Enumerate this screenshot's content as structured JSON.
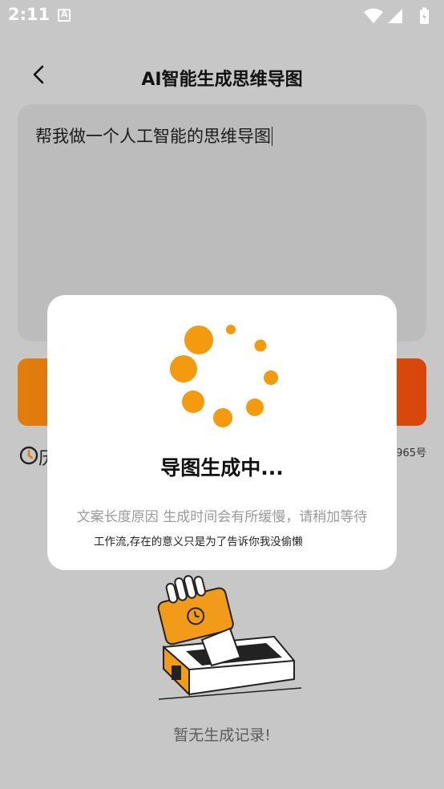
{
  "status_bar": {
    "time": "2:11"
  },
  "header": {
    "title": "AI智能生成思维导图"
  },
  "input": {
    "value": "帮我做一个人工智能的思维导图"
  },
  "history": {
    "label": "历",
    "queue_text": "965号"
  },
  "empty_state": {
    "text": "暂无生成记录!"
  },
  "modal": {
    "title": "导图生成中...",
    "subtitle": "文案长度原因 生成时间会有所缓慢，请稍加等待",
    "tip": "工作流,存在的意义只是为了告诉你我没偷懒"
  },
  "colors": {
    "accent": "#F39A0F",
    "button_start": "#E07E0C",
    "button_end": "#D8450B"
  }
}
